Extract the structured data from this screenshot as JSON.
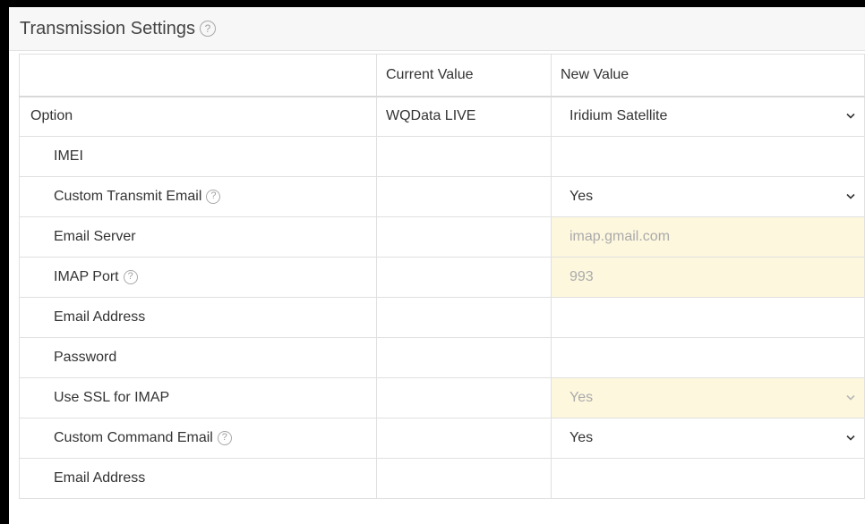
{
  "panel": {
    "title": "Transmission Settings",
    "help_glyph": "?"
  },
  "table": {
    "headers": {
      "option": "",
      "current": "Current Value",
      "new": "New Value"
    },
    "rows": [
      {
        "label": "Option",
        "current": "WQData LIVE",
        "new": "Iridium Satellite"
      },
      {
        "label": "IMEI",
        "current": "",
        "new": ""
      },
      {
        "label": "Custom Transmit Email",
        "current": "",
        "new": "Yes"
      },
      {
        "label": "Email Server",
        "current": "",
        "new": "imap.gmail.com"
      },
      {
        "label": "IMAP Port",
        "current": "",
        "new": "993"
      },
      {
        "label": "Email Address",
        "current": "",
        "new": ""
      },
      {
        "label": "Password",
        "current": "",
        "new": ""
      },
      {
        "label": "Use SSL for IMAP",
        "current": "",
        "new": "Yes"
      },
      {
        "label": "Custom Command Email",
        "current": "",
        "new": "Yes"
      },
      {
        "label": "Email Address",
        "current": "",
        "new": ""
      }
    ]
  },
  "colors": {
    "disabled_bg": "#fdf7de",
    "border": "#e0e0e0",
    "text": "#333333"
  }
}
